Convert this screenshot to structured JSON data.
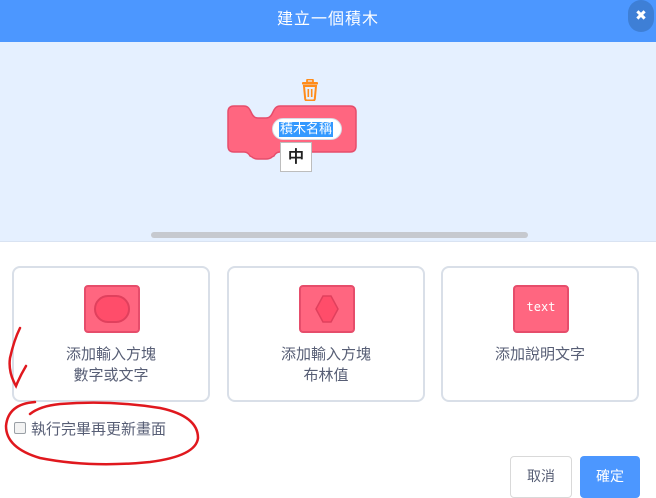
{
  "dialog": {
    "title": "建立一個積木",
    "close_icon": "close-icon"
  },
  "workspace": {
    "block_name_value": "積木名稱",
    "ime_indicator": "中",
    "trash_icon": "trash-icon",
    "block_color": "#ff6680"
  },
  "options": [
    {
      "line1": "添加輸入方塊",
      "line2": "數字或文字",
      "icon": "oval-input-icon"
    },
    {
      "line1": "添加輸入方塊",
      "line2": "布林值",
      "icon": "boolean-input-icon"
    },
    {
      "line1": "添加說明文字",
      "line2": "",
      "icon": "text-label-icon",
      "icon_text": "text"
    }
  ],
  "run_without_refresh_label": "執行完畢再更新畫面",
  "buttons": {
    "cancel": "取消",
    "ok": "確定"
  },
  "colors": {
    "header": "#4c97ff",
    "workspace": "#e5f0ff",
    "block": "#ff6680",
    "annotation": "#e0181e"
  }
}
